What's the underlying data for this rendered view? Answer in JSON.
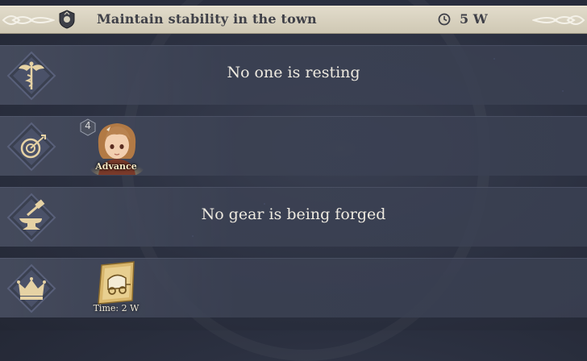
{
  "quest": {
    "title": "Maintain stability in the town",
    "time_remaining": "5 W"
  },
  "rows": [
    {
      "icon": "caduceus-wings-icon",
      "message": "No one is resting"
    },
    {
      "icon": "archery-target-icon",
      "character": {
        "level": "4",
        "status": "Advance"
      }
    },
    {
      "icon": "anvil-hammer-icon",
      "message": "No gear is being forged"
    },
    {
      "icon": "crown-icon",
      "item": {
        "icon": "wagon-scroll-icon",
        "time": "Time:  2 W"
      }
    }
  ],
  "colors": {
    "banner": "#d8d2bf",
    "banner_text": "#3f4048",
    "row_bg": "#434a5c",
    "message_text": "#eeeae0",
    "icon_gold": "#e6d2a4"
  }
}
